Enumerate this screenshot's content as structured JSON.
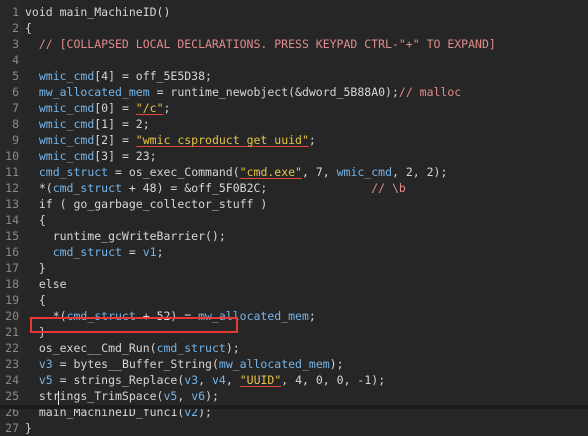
{
  "editor": {
    "lines": [
      {
        "num": "1",
        "parts": [
          {
            "t": "void main_MachineID()",
            "c": "plain"
          }
        ]
      },
      {
        "num": "2",
        "parts": [
          {
            "t": "{",
            "c": "plain"
          }
        ]
      },
      {
        "num": "3",
        "parts": [
          {
            "t": "  // [COLLAPSED LOCAL DECLARATIONS. PRESS KEYPAD CTRL-\"+\" TO EXPAND]",
            "c": "red"
          }
        ]
      },
      {
        "num": "4",
        "parts": [
          {
            "t": "",
            "c": "plain"
          }
        ]
      },
      {
        "num": "5",
        "parts": [
          {
            "t": "  ",
            "c": "plain"
          },
          {
            "t": "wmic_cmd",
            "c": "var"
          },
          {
            "t": "[4] = off_5E5D38;",
            "c": "plain"
          }
        ]
      },
      {
        "num": "6",
        "parts": [
          {
            "t": "  ",
            "c": "plain"
          },
          {
            "t": "mw_allocated_mem",
            "c": "var"
          },
          {
            "t": " = runtime_newobject(&dword_5B88A0);",
            "c": "plain"
          },
          {
            "t": "// malloc",
            "c": "red"
          }
        ]
      },
      {
        "num": "7",
        "parts": [
          {
            "t": "  ",
            "c": "plain"
          },
          {
            "t": "wmic_cmd",
            "c": "var"
          },
          {
            "t": "[0] = ",
            "c": "plain"
          },
          {
            "t": "\"/c\"",
            "c": "str"
          },
          {
            "t": ";",
            "c": "plain"
          }
        ]
      },
      {
        "num": "8",
        "parts": [
          {
            "t": "  ",
            "c": "plain"
          },
          {
            "t": "wmic_cmd",
            "c": "var"
          },
          {
            "t": "[1] = 2;",
            "c": "plain"
          }
        ]
      },
      {
        "num": "9",
        "parts": [
          {
            "t": "  ",
            "c": "plain"
          },
          {
            "t": "wmic_cmd",
            "c": "var"
          },
          {
            "t": "[2] = ",
            "c": "plain"
          },
          {
            "t": "\"wmic csproduct get uuid\"",
            "c": "str"
          },
          {
            "t": ";",
            "c": "plain"
          }
        ]
      },
      {
        "num": "10",
        "parts": [
          {
            "t": "  ",
            "c": "plain"
          },
          {
            "t": "wmic_cmd",
            "c": "var"
          },
          {
            "t": "[3] = 23;",
            "c": "plain"
          }
        ]
      },
      {
        "num": "11",
        "parts": [
          {
            "t": "  ",
            "c": "plain"
          },
          {
            "t": "cmd_struct",
            "c": "var"
          },
          {
            "t": " = os_exec_Command(",
            "c": "plain"
          },
          {
            "t": "\"cmd.exe\"",
            "c": "str"
          },
          {
            "t": ", 7, ",
            "c": "plain"
          },
          {
            "t": "wmic_cmd",
            "c": "var"
          },
          {
            "t": ", 2, 2);",
            "c": "plain"
          }
        ]
      },
      {
        "num": "12",
        "parts": [
          {
            "t": "  *(",
            "c": "plain"
          },
          {
            "t": "cmd_struct",
            "c": "var"
          },
          {
            "t": " + 48) = &off_5F0B2C;",
            "c": "plain"
          },
          {
            "t": "               // \\b",
            "c": "red"
          }
        ]
      },
      {
        "num": "13",
        "parts": [
          {
            "t": "  if ( go_garbage_collector_stuff )",
            "c": "plain"
          }
        ]
      },
      {
        "num": "14",
        "parts": [
          {
            "t": "  {",
            "c": "plain"
          }
        ]
      },
      {
        "num": "15",
        "parts": [
          {
            "t": "    runtime_gcWriteBarrier();",
            "c": "plain"
          }
        ]
      },
      {
        "num": "16",
        "parts": [
          {
            "t": "    ",
            "c": "plain"
          },
          {
            "t": "cmd_struct",
            "c": "var"
          },
          {
            "t": " = ",
            "c": "plain"
          },
          {
            "t": "v1",
            "c": "var"
          },
          {
            "t": ";",
            "c": "plain"
          }
        ]
      },
      {
        "num": "17",
        "parts": [
          {
            "t": "  }",
            "c": "plain"
          }
        ]
      },
      {
        "num": "18",
        "parts": [
          {
            "t": "  else",
            "c": "plain"
          }
        ]
      },
      {
        "num": "19",
        "parts": [
          {
            "t": "  {",
            "c": "plain"
          }
        ]
      },
      {
        "num": "20",
        "parts": [
          {
            "t": "    *(",
            "c": "plain"
          },
          {
            "t": "cmd_struct",
            "c": "var"
          },
          {
            "t": " + 52) = ",
            "c": "plain"
          },
          {
            "t": "mw_allocated_mem",
            "c": "var"
          },
          {
            "t": ";",
            "c": "plain"
          }
        ]
      },
      {
        "num": "21",
        "parts": [
          {
            "t": "  }",
            "c": "plain"
          }
        ]
      },
      {
        "num": "22",
        "parts": [
          {
            "t": "  os_exec__Cmd_Run(",
            "c": "plain"
          },
          {
            "t": "cmd_struct",
            "c": "var"
          },
          {
            "t": ");",
            "c": "plain"
          }
        ]
      },
      {
        "num": "23",
        "parts": [
          {
            "t": "  ",
            "c": "plain"
          },
          {
            "t": "v3",
            "c": "var"
          },
          {
            "t": " = bytes__Buffer_String(",
            "c": "plain"
          },
          {
            "t": "mw_allocated_mem",
            "c": "var"
          },
          {
            "t": ");",
            "c": "plain"
          }
        ]
      },
      {
        "num": "24",
        "parts": [
          {
            "t": "  ",
            "c": "plain"
          },
          {
            "t": "v5",
            "c": "var"
          },
          {
            "t": " = strings_Replace(",
            "c": "plain"
          },
          {
            "t": "v3",
            "c": "var"
          },
          {
            "t": ", ",
            "c": "plain"
          },
          {
            "t": "v4",
            "c": "var"
          },
          {
            "t": ", ",
            "c": "plain"
          },
          {
            "t": "\"UUID\"",
            "c": "str"
          },
          {
            "t": ", 4, 0, 0, -1);",
            "c": "plain"
          }
        ]
      },
      {
        "num": "25",
        "parts": [
          {
            "t": "  strings_TrimSpace(",
            "c": "plain"
          },
          {
            "t": "v5",
            "c": "var"
          },
          {
            "t": ", ",
            "c": "plain"
          },
          {
            "t": "v6",
            "c": "var"
          },
          {
            "t": ");",
            "c": "plain"
          }
        ]
      },
      {
        "num": "26",
        "parts": [
          {
            "t": "  main_MachineID_func1(",
            "c": "plain"
          },
          {
            "t": "v2",
            "c": "var"
          },
          {
            "t": ");",
            "c": "plain"
          }
        ]
      },
      {
        "num": "27",
        "parts": [
          {
            "t": "}",
            "c": "plain"
          }
        ]
      }
    ]
  },
  "colors": {
    "background": "#262626",
    "variable": "#74b4e8",
    "string": "#e7c545",
    "comment_red": "#e08b8b",
    "highlight_box": "#e53a35",
    "plain": "#d6d6d6"
  }
}
